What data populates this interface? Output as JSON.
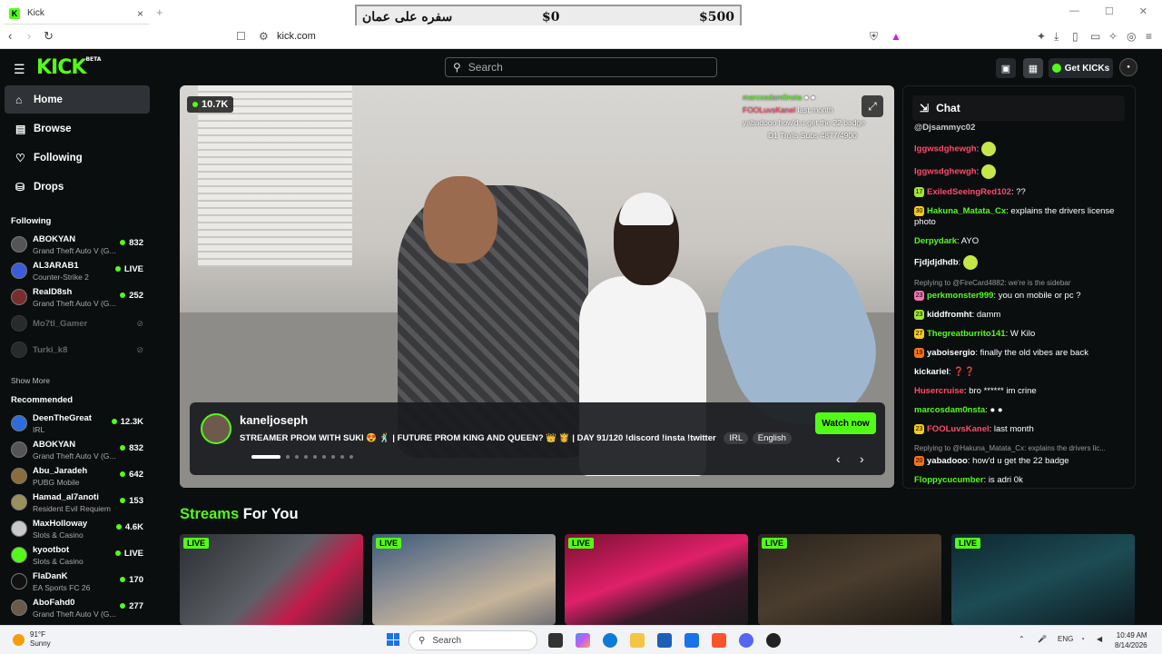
{
  "browser": {
    "tab_title": "Kick",
    "tab_close": "×",
    "new_tab": "+",
    "url": "kick.com",
    "win_min": "—",
    "win_max": "☐",
    "win_close": "✕"
  },
  "ad_overlay": {
    "arabic": "سفره على عمان",
    "left_amount": "$0",
    "right_amount": "$500"
  },
  "header": {
    "logo": "KICK",
    "beta": "BETA",
    "search_placeholder": "Search",
    "get_kicks": "Get KICKs"
  },
  "sidebar": {
    "nav": [
      {
        "label": "Home",
        "icon": "home-icon"
      },
      {
        "label": "Browse",
        "icon": "browse-icon"
      },
      {
        "label": "Following",
        "icon": "heart-icon"
      },
      {
        "label": "Drops",
        "icon": "drops-icon"
      }
    ],
    "following_title": "Following",
    "following": [
      {
        "name": "ABOKYAN",
        "game": "Grand Theft Auto V (G...",
        "viewers": "832"
      },
      {
        "name": "AL3ARAB1",
        "game": "Counter-Strike 2",
        "viewers": "LIVE"
      },
      {
        "name": "RealD8sh",
        "game": "Grand Theft Auto V (G...",
        "viewers": "252"
      },
      {
        "name": "Mo7tl_Gamer",
        "offline": true
      },
      {
        "name": "Turki_k8",
        "offline": true
      }
    ],
    "show_more": "Show More",
    "recommended_title": "Recommended",
    "recommended": [
      {
        "name": "DeenTheGreat",
        "game": "IRL",
        "viewers": "12.3K"
      },
      {
        "name": "ABOKYAN",
        "game": "Grand Theft Auto V (G...",
        "viewers": "832"
      },
      {
        "name": "Abu_Jaradeh",
        "game": "PUBG Mobile",
        "viewers": "642"
      },
      {
        "name": "Hamad_al7anoti",
        "game": "Resident Evil Requiem",
        "viewers": "153"
      },
      {
        "name": "MaxHolloway",
        "game": "Slots & Casino",
        "viewers": "4.6K"
      },
      {
        "name": "kyootbot",
        "game": "Slots & Casino",
        "viewers": "LIVE"
      },
      {
        "name": "FlaDanK",
        "game": "EA Sports FC 26",
        "viewers": "170"
      },
      {
        "name": "AboFahd0",
        "game": "Grand Theft Auto V (G...",
        "viewers": "277"
      }
    ]
  },
  "hero": {
    "viewers": "10.7K",
    "overlay_lines": [
      {
        "user": "marcosdam0nsta",
        "text": "● ●"
      },
      {
        "user": "FOOLuvsKanel",
        "text": "last month"
      },
      {
        "user": "yabadooo",
        "text": "how'd u get the 22 badge"
      },
      {
        "user": "",
        "text": "D1 Trolls Subs 4877/4900"
      }
    ],
    "streamer": "kaneljoseph",
    "title": "STREAMER PROM WITH SUKI 😍 🕺 | FUTURE PROM KING AND QUEEN? 👑 👸 | DAY 91/120 !discord !insta !twitter",
    "tags": [
      "IRL",
      "English"
    ],
    "watch_now": "Watch now"
  },
  "streams_for_you": {
    "part1": "Streams",
    "part2": "For You",
    "live_label": "LIVE"
  },
  "chat": {
    "title": "Chat",
    "messages": [
      {
        "user": "@Djsammyc02",
        "color": "#cccccc",
        "text": ""
      },
      {
        "user": "Iggwsdghewgh",
        "color": "#ff4b6b",
        "text": "",
        "emote": true
      },
      {
        "user": "Iggwsdghewgh",
        "color": "#ff4b6b",
        "text": "",
        "emote": true
      },
      {
        "badge": "17",
        "user": "ExiledSeeingRed102",
        "color": "#ff4b6b",
        "text": "??"
      },
      {
        "badge": "30",
        "user": "Hakuna_Matata_Cx",
        "color": "#53fc18",
        "text": "explains the drivers license photo"
      },
      {
        "user": "Derpydark",
        "color": "#53fc18",
        "text": "AYO"
      },
      {
        "user": "Fjdjdjdhdb",
        "color": "#ffffff",
        "text": "",
        "emote": true
      },
      {
        "reply": "Replying to @FireCard4882: we're is the sidebar",
        "badge": "23",
        "user": "perkmonster999",
        "color": "#53fc18",
        "text": "you on mobile or pc ?"
      },
      {
        "badge": "23",
        "user": "kiddfromht",
        "color": "#ffffff",
        "text": "damm"
      },
      {
        "badge": "27",
        "user": "Thegreatburrito141",
        "color": "#53fc18",
        "text": "W Kilo"
      },
      {
        "badge": "19",
        "user": "yaboisergio",
        "color": "#ffffff",
        "text": "finally the old vibes are back"
      },
      {
        "user": "kickariel",
        "color": "#ffffff",
        "text": "❓❓"
      },
      {
        "user": "Husercruise",
        "color": "#ff4b6b",
        "text": "bro ****** im crine"
      },
      {
        "user": "marcosdam0nsta",
        "color": "#53fc18",
        "text": "● ●"
      },
      {
        "badge": "23",
        "user": "FOOLuvsKanel",
        "color": "#ff4b6b",
        "text": "last month"
      },
      {
        "reply": "Replying to @Hakuna_Matata_Cx: explains the drivers lic...",
        "badge": "20",
        "user": "yabadooo",
        "color": "#ffffff",
        "text": "how'd u get the 22 badge"
      },
      {
        "user": "Floppycucumber",
        "color": "#53fc18",
        "text": "is adri 0k"
      }
    ]
  },
  "taskbar": {
    "temp": "91°F",
    "weather": "Sunny",
    "search": "Search",
    "lang": "ENG",
    "time": "10:49 AM",
    "date": "8/14/2026"
  }
}
